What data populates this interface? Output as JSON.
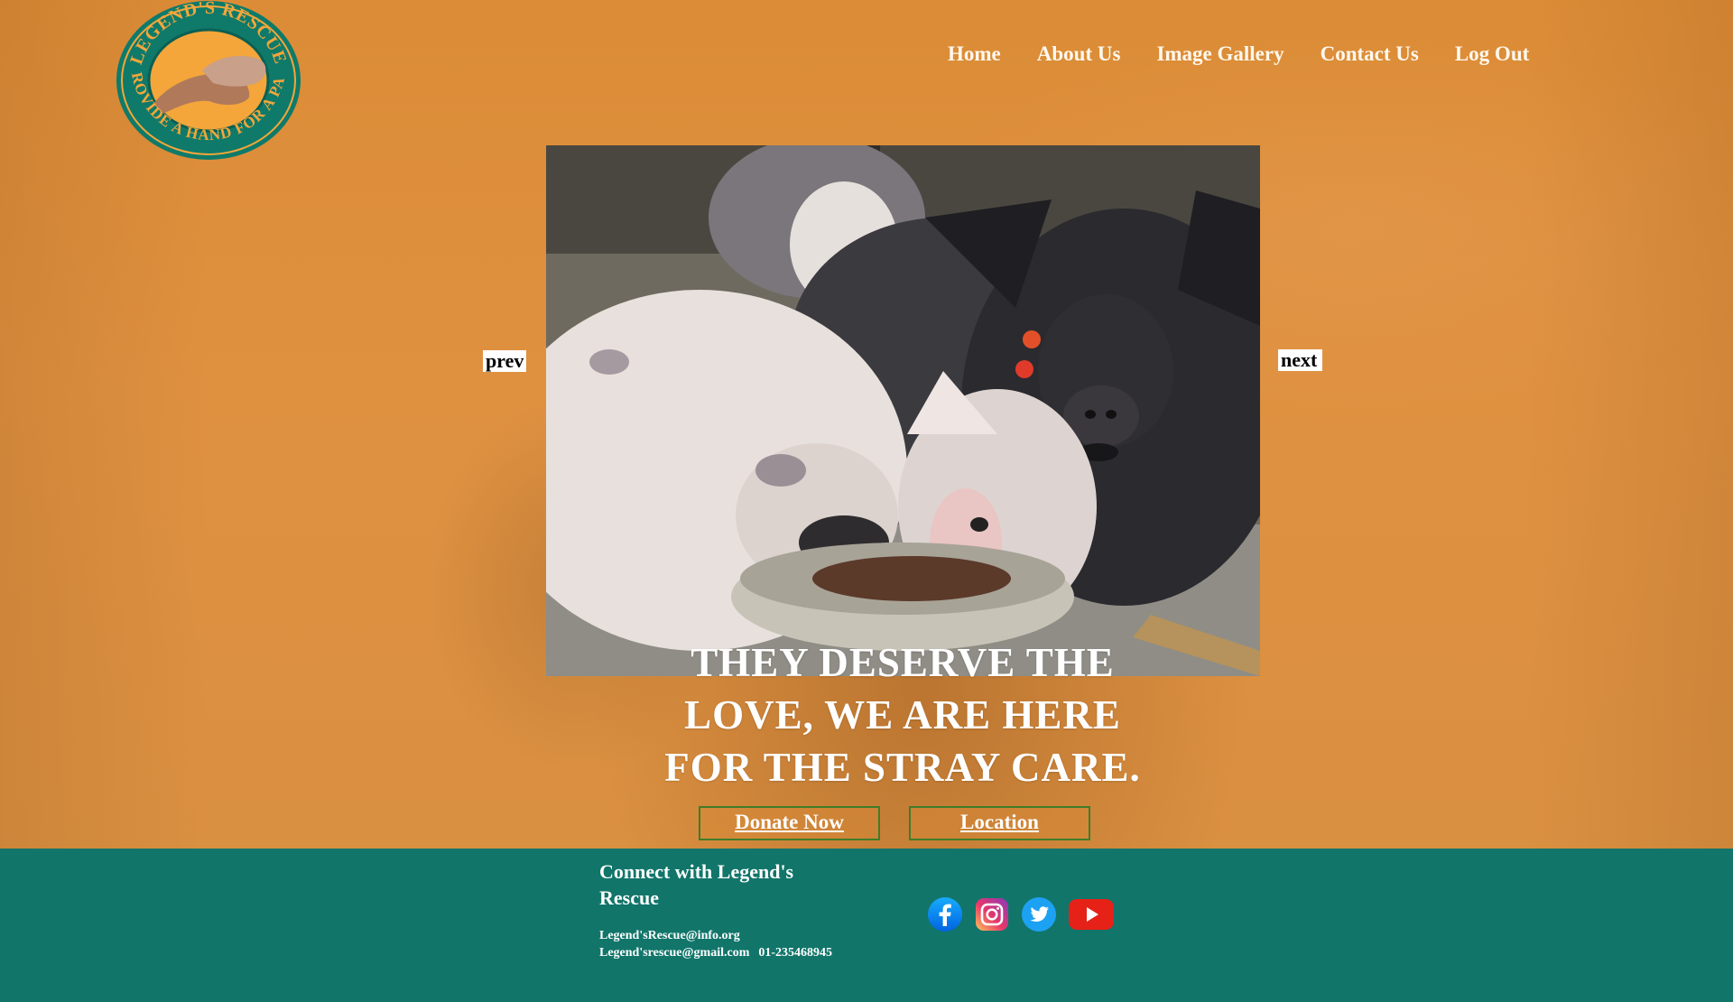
{
  "logo": {
    "top_text": "LEGEND'S RESCUE",
    "bottom_text": "PROVIDE A HAND FOR A PAW"
  },
  "nav": {
    "items": [
      {
        "label": "Home"
      },
      {
        "label": "About Us"
      },
      {
        "label": "Image Gallery"
      },
      {
        "label": "Contact Us"
      },
      {
        "label": "Log Out"
      }
    ]
  },
  "slider": {
    "prev_label": "prev",
    "next_label": "next",
    "image_subject": "pigs eating from a bowl"
  },
  "hero": {
    "headline_line1": "THEY DESERVE THE",
    "headline_line2": "LOVE, WE ARE HERE",
    "headline_line3": "FOR THE STRAY CARE.",
    "donate_label": "Donate Now",
    "location_label": "Location"
  },
  "footer": {
    "title": "Connect with Legend's Rescue",
    "email1": "Legend'sRescue@info.org",
    "email2": "Legend'srescue@gmail.com",
    "phone": "01-235468945",
    "social": [
      "facebook-icon",
      "instagram-icon",
      "twitter-icon",
      "youtube-icon"
    ]
  },
  "colors": {
    "hero_orange": "#dc8c36",
    "footer_teal": "#11756a",
    "logo_teal": "#0f7a6a",
    "logo_gold": "#f4a63a"
  }
}
